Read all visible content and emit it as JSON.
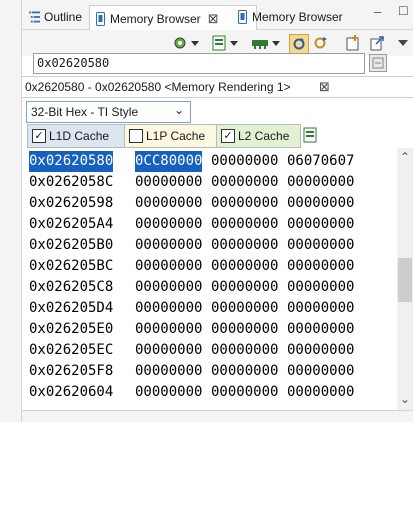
{
  "tabs": {
    "outline": {
      "label": "Outline",
      "icon": "outline-icon"
    },
    "memory_active": {
      "label": "Memory Browser",
      "icon": "memory-browser-icon",
      "close": "⊠"
    },
    "memory_other": {
      "label": "Memory Browser",
      "icon": "memory-browser-icon"
    }
  },
  "window": {
    "minimize": "–",
    "maximize": "☐"
  },
  "address": {
    "value": "0x02620580"
  },
  "rendering": {
    "tab_label": "0x2620580 - 0x02620580 <Memory Rendering 1>",
    "close": "⊠"
  },
  "format": {
    "selected": "32-Bit Hex - TI Style",
    "arrow": "⌄"
  },
  "cache": [
    {
      "label": "L1D Cache",
      "checked": true,
      "color": "#dce6f1"
    },
    {
      "label": "L1P Cache",
      "checked": false,
      "color": "#fdf8e0"
    },
    {
      "label": "L2 Cache",
      "checked": true,
      "color": "#e1f2d4"
    }
  ],
  "check_mark": "✓",
  "memory": {
    "rows": [
      {
        "addr": "0x02620580",
        "v0": "0CC80000",
        "v1": "00000000",
        "v2": "06070607"
      },
      {
        "addr": "0x0262058C",
        "v0": "00000000",
        "v1": "00000000",
        "v2": "00000000"
      },
      {
        "addr": "0x02620598",
        "v0": "00000000",
        "v1": "00000000",
        "v2": "00000000"
      },
      {
        "addr": "0x026205A4",
        "v0": "00000000",
        "v1": "00000000",
        "v2": "00000000"
      },
      {
        "addr": "0x026205B0",
        "v0": "00000000",
        "v1": "00000000",
        "v2": "00000000"
      },
      {
        "addr": "0x026205BC",
        "v0": "00000000",
        "v1": "00000000",
        "v2": "00000000"
      },
      {
        "addr": "0x026205C8",
        "v0": "00000000",
        "v1": "00000000",
        "v2": "00000000"
      },
      {
        "addr": "0x026205D4",
        "v0": "00000000",
        "v1": "00000000",
        "v2": "00000000"
      },
      {
        "addr": "0x026205E0",
        "v0": "00000000",
        "v1": "00000000",
        "v2": "00000000"
      },
      {
        "addr": "0x026205EC",
        "v0": "00000000",
        "v1": "00000000",
        "v2": "00000000"
      },
      {
        "addr": "0x026205F8",
        "v0": "00000000",
        "v1": "00000000",
        "v2": "00000000"
      },
      {
        "addr": "0x02620604",
        "v0": "00000000",
        "v1": "00000000",
        "v2": "00000000"
      }
    ]
  },
  "scrollbar": {
    "up": "⌃",
    "down": "⌄"
  },
  "colors": {
    "selection": "#1560c0",
    "accent": "#2e7d32"
  }
}
